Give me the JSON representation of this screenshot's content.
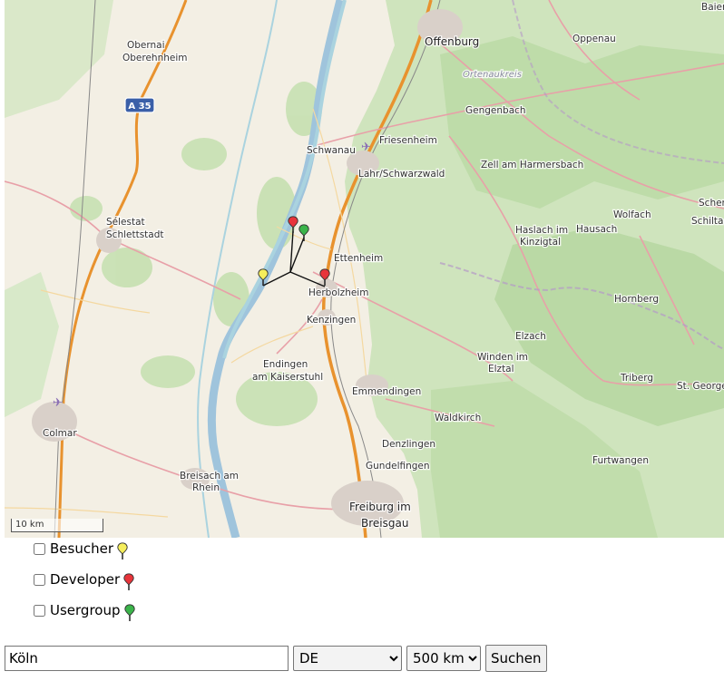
{
  "map": {
    "places": [
      {
        "name": "Obernai"
      },
      {
        "name": "Oberehnheim"
      },
      {
        "name": "Offenburg"
      },
      {
        "name": "Oppenau"
      },
      {
        "name": "Baier"
      },
      {
        "name": "Ortenaukreis"
      },
      {
        "name": "A 35"
      },
      {
        "name": "Gengenbach"
      },
      {
        "name": "Schwanau"
      },
      {
        "name": "Friesenheim"
      },
      {
        "name": "Lahr/Schwarzwald"
      },
      {
        "name": "Zell am Harmersbach"
      },
      {
        "name": "Scher"
      },
      {
        "name": "Wolfach"
      },
      {
        "name": "Schiltac"
      },
      {
        "name": "Sélestat"
      },
      {
        "name": "Schlettstadt"
      },
      {
        "name": "Haslach im"
      },
      {
        "name": "Kinzigtal"
      },
      {
        "name": "Hausach"
      },
      {
        "name": "Ettenheim"
      },
      {
        "name": "Herbolzheim"
      },
      {
        "name": "Hornberg"
      },
      {
        "name": "Kenzingen"
      },
      {
        "name": "Elzach"
      },
      {
        "name": "Endingen"
      },
      {
        "name": "am Kaiserstuhl"
      },
      {
        "name": "Winden im"
      },
      {
        "name": "Elztal"
      },
      {
        "name": "Triberg"
      },
      {
        "name": "St. Georgen"
      },
      {
        "name": "Emmendingen"
      },
      {
        "name": "Waldkirch"
      },
      {
        "name": "Colmar"
      },
      {
        "name": "Denzlingen"
      },
      {
        "name": "Furtwangen"
      },
      {
        "name": "Gundelfingen"
      },
      {
        "name": "Breisach am"
      },
      {
        "name": "Rhein"
      },
      {
        "name": "Freiburg im"
      },
      {
        "name": "Breisgau"
      }
    ],
    "scale_label": "10 km",
    "markers": [
      {
        "type": "developer",
        "color": "#e8343a"
      },
      {
        "type": "usergroup",
        "color": "#3bb44a"
      },
      {
        "type": "besucher",
        "color": "#f5ee5c"
      },
      {
        "type": "developer",
        "color": "#e8343a"
      }
    ]
  },
  "legend": [
    {
      "label": "Besucher",
      "color": "#f5ee5c",
      "icon": "yellow-pin-icon"
    },
    {
      "label": "Developer",
      "color": "#e8343a",
      "icon": "red-pin-icon"
    },
    {
      "label": "Usergroup",
      "color": "#3bb44a",
      "icon": "green-pin-icon"
    }
  ],
  "search": {
    "city_value": "Köln",
    "country_selected": "DE",
    "radius_selected": "500 km",
    "button_label": "Suchen"
  }
}
